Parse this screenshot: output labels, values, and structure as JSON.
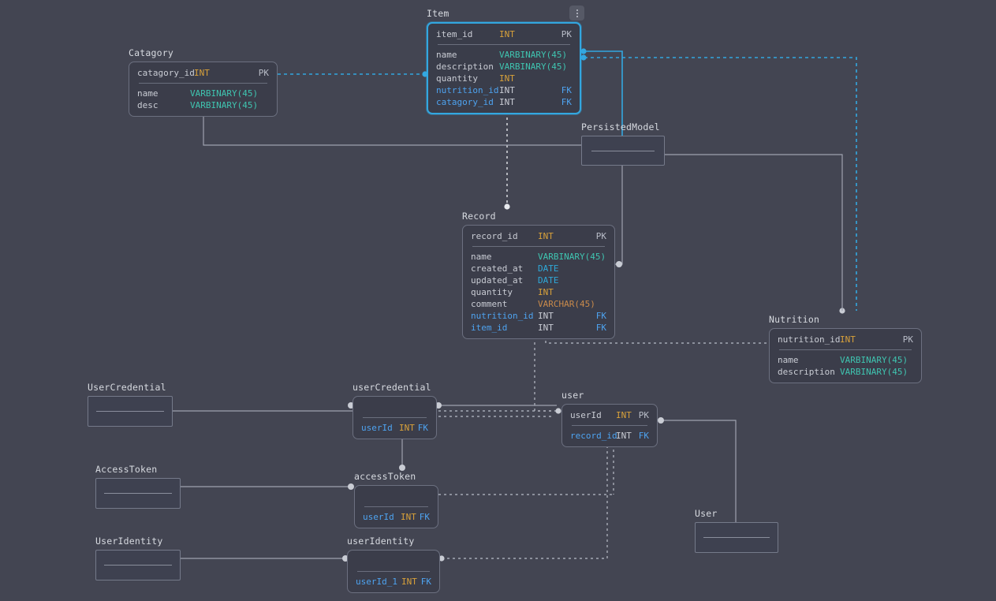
{
  "diagram": {
    "background_color": "#434552",
    "accent_color": "#33a7e0",
    "menu_button": {
      "name": "node-options-menu",
      "glyph": "vertical-dots"
    }
  },
  "type_colors": {
    "INT": "#d8a13a",
    "VARBINARY": "#3fc4b0",
    "DATE": "#2fa8d8",
    "VARCHAR": "#c98a4b",
    "FK": "#4ea3f0",
    "PK": "#b9bdc8"
  },
  "entities": {
    "item": {
      "title": "Item",
      "selected": true,
      "pk": {
        "name": "item_id",
        "type": "INT",
        "key": "PK"
      },
      "fields": [
        {
          "name": "name",
          "type": "VARBINARY(45)",
          "key": "",
          "fk": false
        },
        {
          "name": "description",
          "type": "VARBINARY(45)",
          "key": "",
          "fk": false
        },
        {
          "name": "quantity",
          "type": "INT",
          "key": "",
          "fk": false
        },
        {
          "name": "nutrition_id",
          "type": "INT",
          "key": "FK",
          "fk": true
        },
        {
          "name": "catagory_id",
          "type": "INT",
          "key": "FK",
          "fk": true
        }
      ]
    },
    "catagory": {
      "title": "Catagory",
      "selected": false,
      "pk": {
        "name": "catagory_id",
        "type": "INT",
        "key": "PK"
      },
      "fields": [
        {
          "name": "name",
          "type": "VARBINARY(45)",
          "key": "",
          "fk": false
        },
        {
          "name": "desc",
          "type": "VARBINARY(45)",
          "key": "",
          "fk": false
        }
      ]
    },
    "record": {
      "title": "Record",
      "selected": false,
      "pk": {
        "name": "record_id",
        "type": "INT",
        "key": "PK"
      },
      "fields": [
        {
          "name": "name",
          "type": "VARBINARY(45)",
          "key": "",
          "fk": false
        },
        {
          "name": "created_at",
          "type": "DATE",
          "key": "",
          "fk": false
        },
        {
          "name": "updated_at",
          "type": "DATE",
          "key": "",
          "fk": false
        },
        {
          "name": "quantity",
          "type": "INT",
          "key": "",
          "fk": false
        },
        {
          "name": "comment",
          "type": "VARCHAR(45)",
          "key": "",
          "fk": false
        },
        {
          "name": "nutrition_id",
          "type": "INT",
          "key": "FK",
          "fk": true
        },
        {
          "name": "item_id",
          "type": "INT",
          "key": "FK",
          "fk": true
        }
      ]
    },
    "nutrition": {
      "title": "Nutrition",
      "selected": false,
      "pk": {
        "name": "nutrition_id",
        "type": "INT",
        "key": "PK"
      },
      "fields": [
        {
          "name": "name",
          "type": "VARBINARY(45)",
          "key": "",
          "fk": false
        },
        {
          "name": "description",
          "type": "VARBINARY(45)",
          "key": "",
          "fk": false
        }
      ]
    },
    "user": {
      "title": "user",
      "selected": false,
      "pk": {
        "name": "userId",
        "type": "INT",
        "key": "PK"
      },
      "fields": [
        {
          "name": "record_id",
          "type": "INT",
          "key": "FK",
          "fk": true
        }
      ]
    },
    "user_credential": {
      "title": "userCredential",
      "selected": false,
      "pk": null,
      "fields": [
        {
          "name": "userId",
          "type": "INT",
          "key": "FK",
          "fk": true
        }
      ]
    },
    "access_token": {
      "title": "accessToken",
      "selected": false,
      "pk": null,
      "fields": [
        {
          "name": "userId",
          "type": "INT",
          "key": "FK",
          "fk": true
        }
      ]
    },
    "user_identity": {
      "title": "userIdentity",
      "selected": false,
      "pk": null,
      "fields": [
        {
          "name": "userId_1",
          "type": "INT",
          "key": "FK",
          "fk": true
        }
      ]
    },
    "persisted_model": {
      "title": "PersistedModel",
      "empty": true
    },
    "user_credential_b": {
      "title": "UserCredential",
      "empty": true
    },
    "access_token_b": {
      "title": "AccessToken",
      "empty": true
    },
    "user_identity_b": {
      "title": "UserIdentity",
      "empty": true
    },
    "user_b": {
      "title": "User",
      "empty": true
    }
  }
}
